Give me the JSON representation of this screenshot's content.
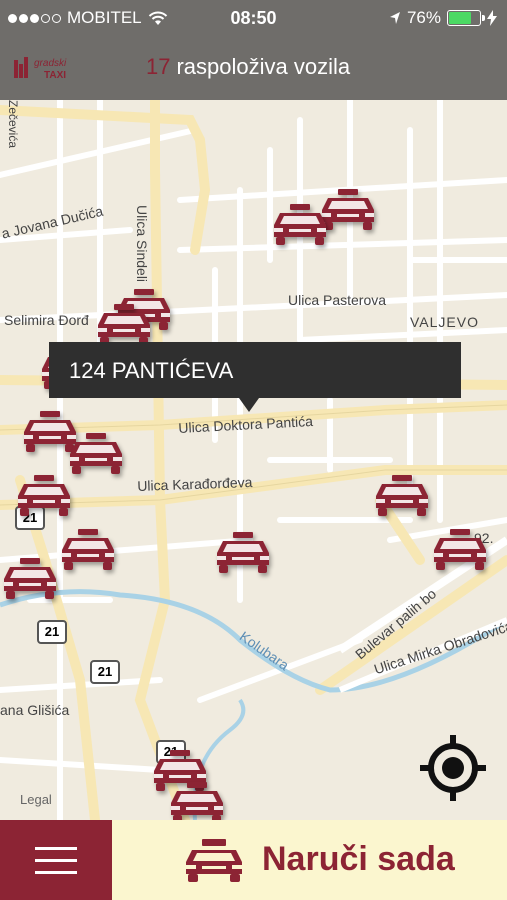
{
  "status_bar": {
    "carrier": "MOBITEL",
    "time": "08:50",
    "battery_percent": "76%",
    "battery_level": 0.76,
    "battery_color": "#4cd964"
  },
  "header": {
    "vehicle_count": "17",
    "title": "raspoloživa vozila",
    "logo_text_line1": "gradski",
    "logo_text_line2": "TAXI"
  },
  "map": {
    "labels": {
      "jovana_ducica": "a Jovana Dučića",
      "sinde": "Ulica Sindeli",
      "selimira": "Selimira Đorđ",
      "pasterova": "Ulica Pasterova",
      "valjevo": "VALJEVO",
      "doktora_pantica": "Ulica Doktora Pantića",
      "karadjordjeva": "Ulica Karađorđeva",
      "bulevar": "Bulevar palih bo",
      "num92": "92.",
      "kolubara": "Kolubara",
      "mirka": "Ulica Mirka Obradovića",
      "glisica": "ana Glišića",
      "zecevica": "Zečevića",
      "legal": "Legal"
    },
    "route_badges": [
      "21",
      "21",
      "21",
      "21"
    ]
  },
  "tooltip": {
    "address": "124 PANTIĆEVA"
  },
  "bottom_bar": {
    "order_label": "Naruči sada"
  },
  "colors": {
    "brand": "#8c2434",
    "header_bg": "#6f6d6a",
    "order_bg": "#fbf6cf"
  },
  "icons": [
    "wifi-icon",
    "location-arrow-icon",
    "charging-icon",
    "taxi-icon",
    "locate-me-icon",
    "hamburger-menu-icon"
  ]
}
